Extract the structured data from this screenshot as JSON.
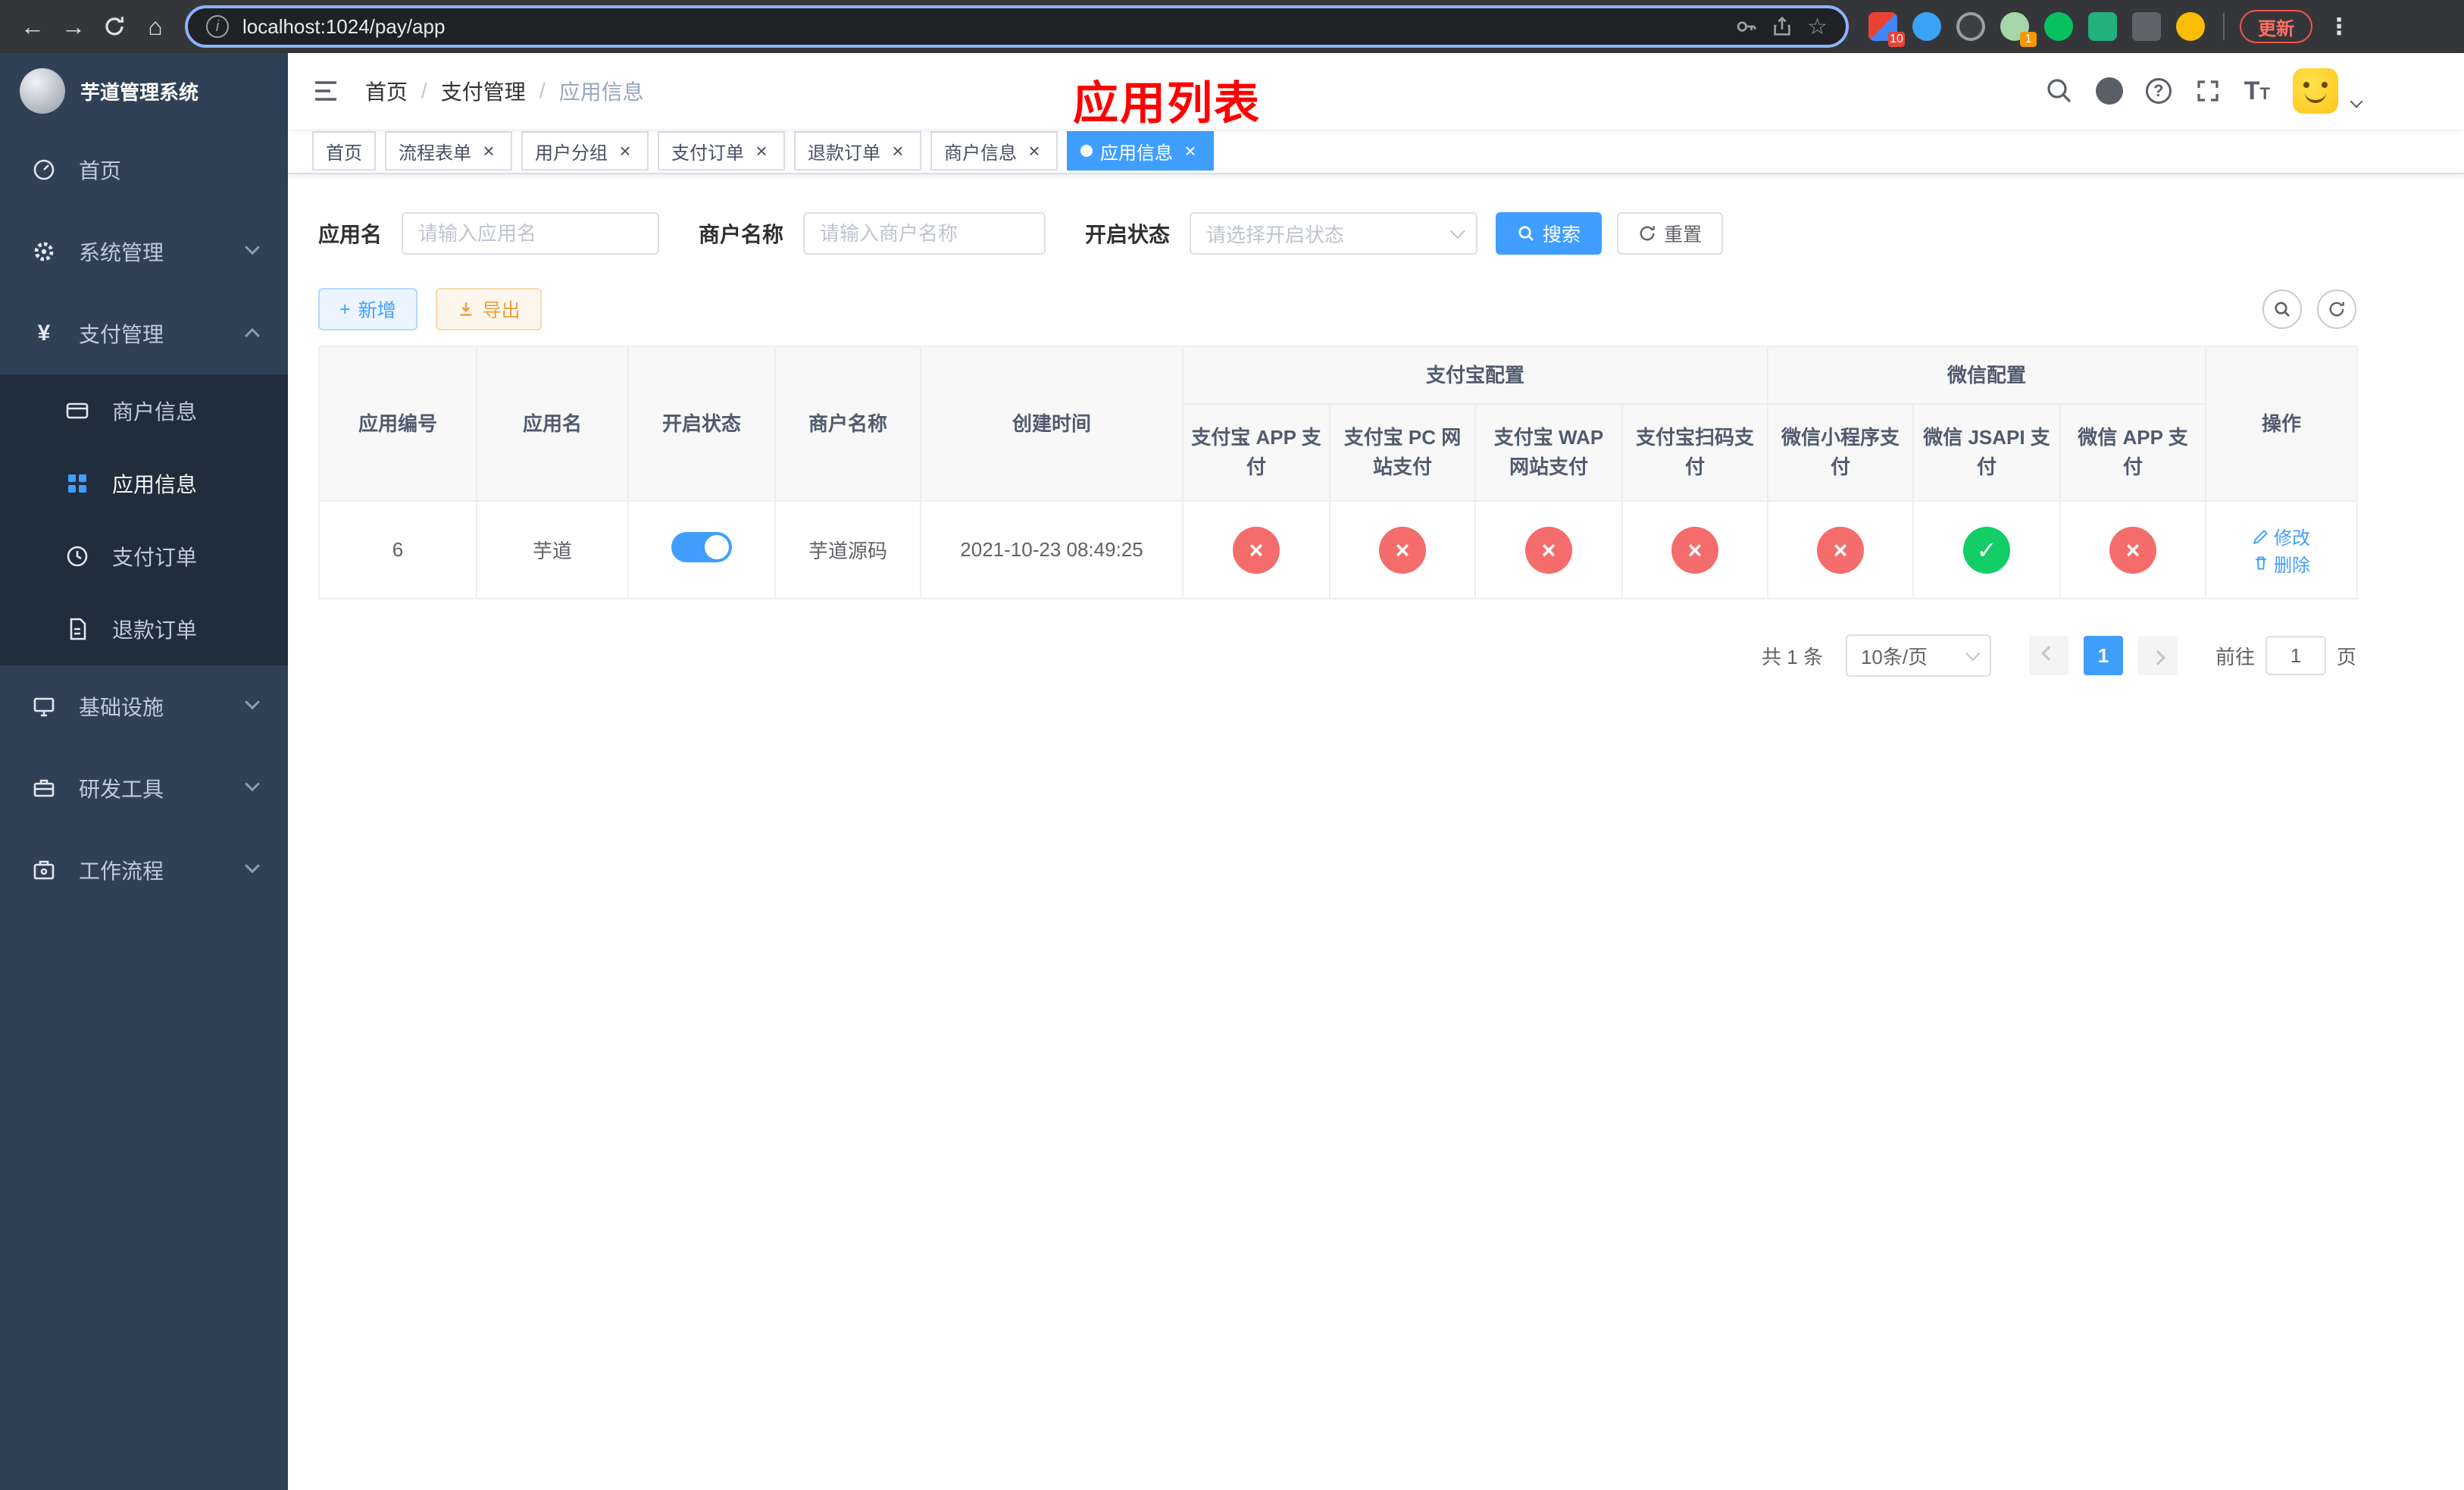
{
  "colors": {
    "accent": "#409EFF",
    "success": "#13CE66",
    "danger": "#F56C6C",
    "warning": "#E6A23C",
    "page_title_red": "#FF0000",
    "sidebar_bg": "#304156",
    "submenu_bg": "#1F2D3D"
  },
  "glyphs": {
    "back": "←",
    "forward": "→",
    "home": "⌂",
    "info": "i",
    "star": "☆",
    "menu_dots": "⋮",
    "check": "✓",
    "cross": "×",
    "plus": "+",
    "question": "?",
    "slash": "/",
    "yen": "¥",
    "font_large": "T",
    "font_small": "T"
  },
  "browser": {
    "url": "localhost:1024/pay/app",
    "update_label": "更新",
    "extensions": [
      {
        "name": "extension-multicolor",
        "badge": "10"
      },
      {
        "name": "extension-blue"
      },
      {
        "name": "extension-dark"
      },
      {
        "name": "extension-light-green",
        "badge": "1"
      },
      {
        "name": "extension-wechat-green"
      },
      {
        "name": "extension-chat-square"
      },
      {
        "name": "extension-puzzle"
      },
      {
        "name": "extension-yellow-face"
      }
    ]
  },
  "sidebar": {
    "title": "芋道管理系统",
    "menu": [
      {
        "label": "首页"
      },
      {
        "label": "系统管理"
      },
      {
        "label": "支付管理"
      },
      {
        "label": "基础设施"
      },
      {
        "label": "研发工具"
      },
      {
        "label": "工作流程"
      }
    ],
    "submenu": [
      {
        "label": "商户信息"
      },
      {
        "label": "应用信息",
        "active": true
      },
      {
        "label": "支付订单"
      },
      {
        "label": "退款订单"
      }
    ]
  },
  "header": {
    "breadcrumb": [
      "首页",
      "支付管理",
      "应用信息"
    ],
    "page_title": "应用列表"
  },
  "tabs": [
    {
      "label": "首页",
      "closable": false,
      "active": false
    },
    {
      "label": "流程表单",
      "closable": true,
      "active": false
    },
    {
      "label": "用户分组",
      "closable": true,
      "active": false
    },
    {
      "label": "支付订单",
      "closable": true,
      "active": false
    },
    {
      "label": "退款订单",
      "closable": true,
      "active": false
    },
    {
      "label": "商户信息",
      "closable": true,
      "active": false
    },
    {
      "label": "应用信息",
      "closable": true,
      "active": true
    }
  ],
  "filters": {
    "app_name_label": "应用名",
    "app_name_placeholder": "请输入应用名",
    "merchant_label": "商户名称",
    "merchant_placeholder": "请输入商户名称",
    "status_label": "开启状态",
    "status_placeholder": "请选择开启状态",
    "search_label": "搜索",
    "reset_label": "重置"
  },
  "toolbar": {
    "add_label": "新增",
    "export_label": "导出"
  },
  "table": {
    "headers": {
      "app_id": "应用编号",
      "app_name": "应用名",
      "status": "开启状态",
      "merchant": "商户名称",
      "created": "创建时间",
      "alipay_group": "支付宝配置",
      "wechat_group": "微信配置",
      "alipay_app": "支付宝 APP 支付",
      "alipay_pc": "支付宝 PC 网站支付",
      "alipay_wap": "支付宝 WAP 网站支付",
      "alipay_scan": "支付宝扫码支付",
      "wechat_mini": "微信小程序支付",
      "wechat_jsapi": "微信 JSAPI 支付",
      "wechat_app": "微信 APP 支付",
      "actions": "操作"
    },
    "row": {
      "app_id": "6",
      "app_name": "芋道",
      "status_on": true,
      "merchant": "芋道源码",
      "created": "2021-10-23 08:49:25",
      "alipay_app": false,
      "alipay_pc": false,
      "alipay_wap": false,
      "alipay_scan": false,
      "wechat_mini": false,
      "wechat_jsapi": true,
      "wechat_app": false,
      "edit_label": "修改",
      "delete_label": "删除"
    }
  },
  "pagination": {
    "total": "共 1 条",
    "page_size": "10条/页",
    "page": "1",
    "goto_label": "前往",
    "goto_value": "1",
    "goto_unit": "页"
  }
}
